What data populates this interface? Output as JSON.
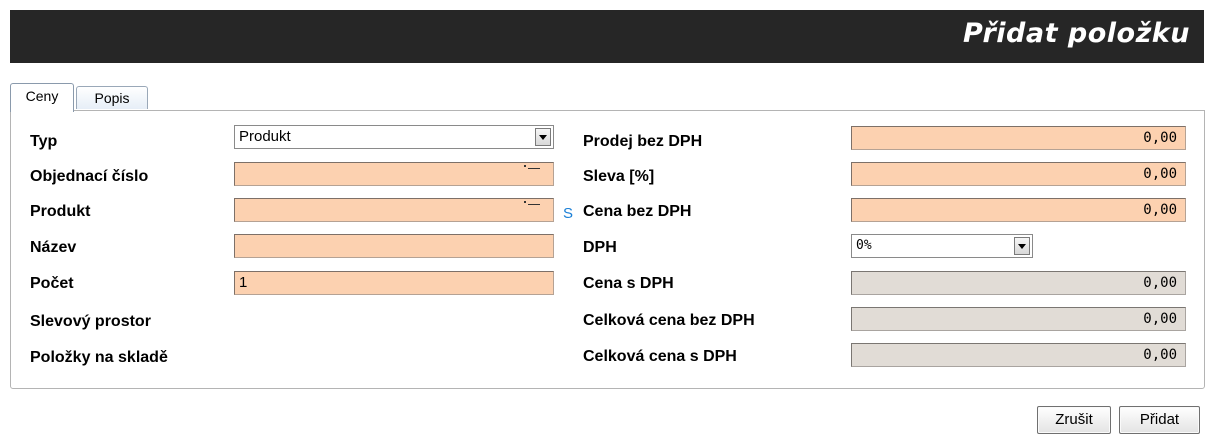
{
  "header": {
    "title": "Přidat položku"
  },
  "tabs": [
    {
      "label": "Ceny",
      "active": true
    },
    {
      "label": "Popis",
      "active": false
    }
  ],
  "left": {
    "typ": {
      "label": "Typ",
      "value": "Produkt"
    },
    "objednaci_cislo": {
      "label": "Objednací číslo",
      "value": ""
    },
    "produkt": {
      "label": "Produkt",
      "value": "",
      "link": "S"
    },
    "nazev": {
      "label": "Název",
      "value": ""
    },
    "pocet": {
      "label": "Počet",
      "value": "1"
    },
    "slevovy_prostor": {
      "label": "Slevový prostor"
    },
    "polozky_na_sklade": {
      "label": "Položky na skladě"
    }
  },
  "right": {
    "prodej_bez_dph": {
      "label": "Prodej bez DPH",
      "value": "0,00"
    },
    "sleva": {
      "label": "Sleva [%]",
      "value": "0,00"
    },
    "cena_bez_dph": {
      "label": "Cena bez DPH",
      "value": "0,00"
    },
    "dph": {
      "label": "DPH",
      "value": "0%"
    },
    "cena_s_dph": {
      "label": "Cena s DPH",
      "value": "0,00"
    },
    "celkova_cena_bez_dph": {
      "label": "Celková cena bez DPH",
      "value": "0,00"
    },
    "celkova_cena_s_dph": {
      "label": "Celková cena s DPH",
      "value": "0,00"
    }
  },
  "buttons": {
    "cancel": "Zrušit",
    "add": "Přidat"
  },
  "colors": {
    "editable_field": "#fcd1b0",
    "readonly_field": "#e1dcd6",
    "header_bg": "#262626",
    "link": "#1a7fd6"
  }
}
